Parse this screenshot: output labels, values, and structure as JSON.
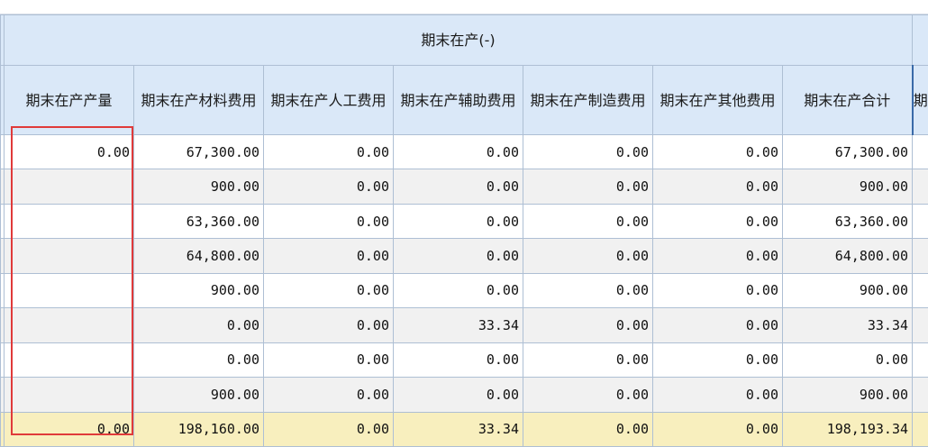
{
  "table": {
    "group_header": "期末在产(-)",
    "columns": [
      "期末在产产量",
      "期末在产材料费用",
      "期末在产人工费用",
      "期末在产辅助费用",
      "期末在产制造费用",
      "期末在产其他费用",
      "期末在产合计"
    ],
    "next_column_fragment": "期",
    "rows": [
      [
        "0.00",
        "67,300.00",
        "0.00",
        "0.00",
        "0.00",
        "0.00",
        "67,300.00"
      ],
      [
        "",
        "900.00",
        "0.00",
        "0.00",
        "0.00",
        "0.00",
        "900.00"
      ],
      [
        "",
        "63,360.00",
        "0.00",
        "0.00",
        "0.00",
        "0.00",
        "63,360.00"
      ],
      [
        "",
        "64,800.00",
        "0.00",
        "0.00",
        "0.00",
        "0.00",
        "64,800.00"
      ],
      [
        "",
        "900.00",
        "0.00",
        "0.00",
        "0.00",
        "0.00",
        "900.00"
      ],
      [
        "",
        "0.00",
        "0.00",
        "33.34",
        "0.00",
        "0.00",
        "33.34"
      ],
      [
        "",
        "0.00",
        "0.00",
        "0.00",
        "0.00",
        "0.00",
        "0.00"
      ],
      [
        "",
        "900.00",
        "0.00",
        "0.00",
        "0.00",
        "0.00",
        "900.00"
      ]
    ],
    "total_row": [
      "0.00",
      "198,160.00",
      "0.00",
      "33.34",
      "0.00",
      "0.00",
      "198,193.34"
    ]
  },
  "colors": {
    "header_bg": "#dae8f8",
    "row_alt_bg": "#f1f1f1",
    "total_bg": "#f8efbe",
    "highlight_border": "#e03a3a"
  }
}
